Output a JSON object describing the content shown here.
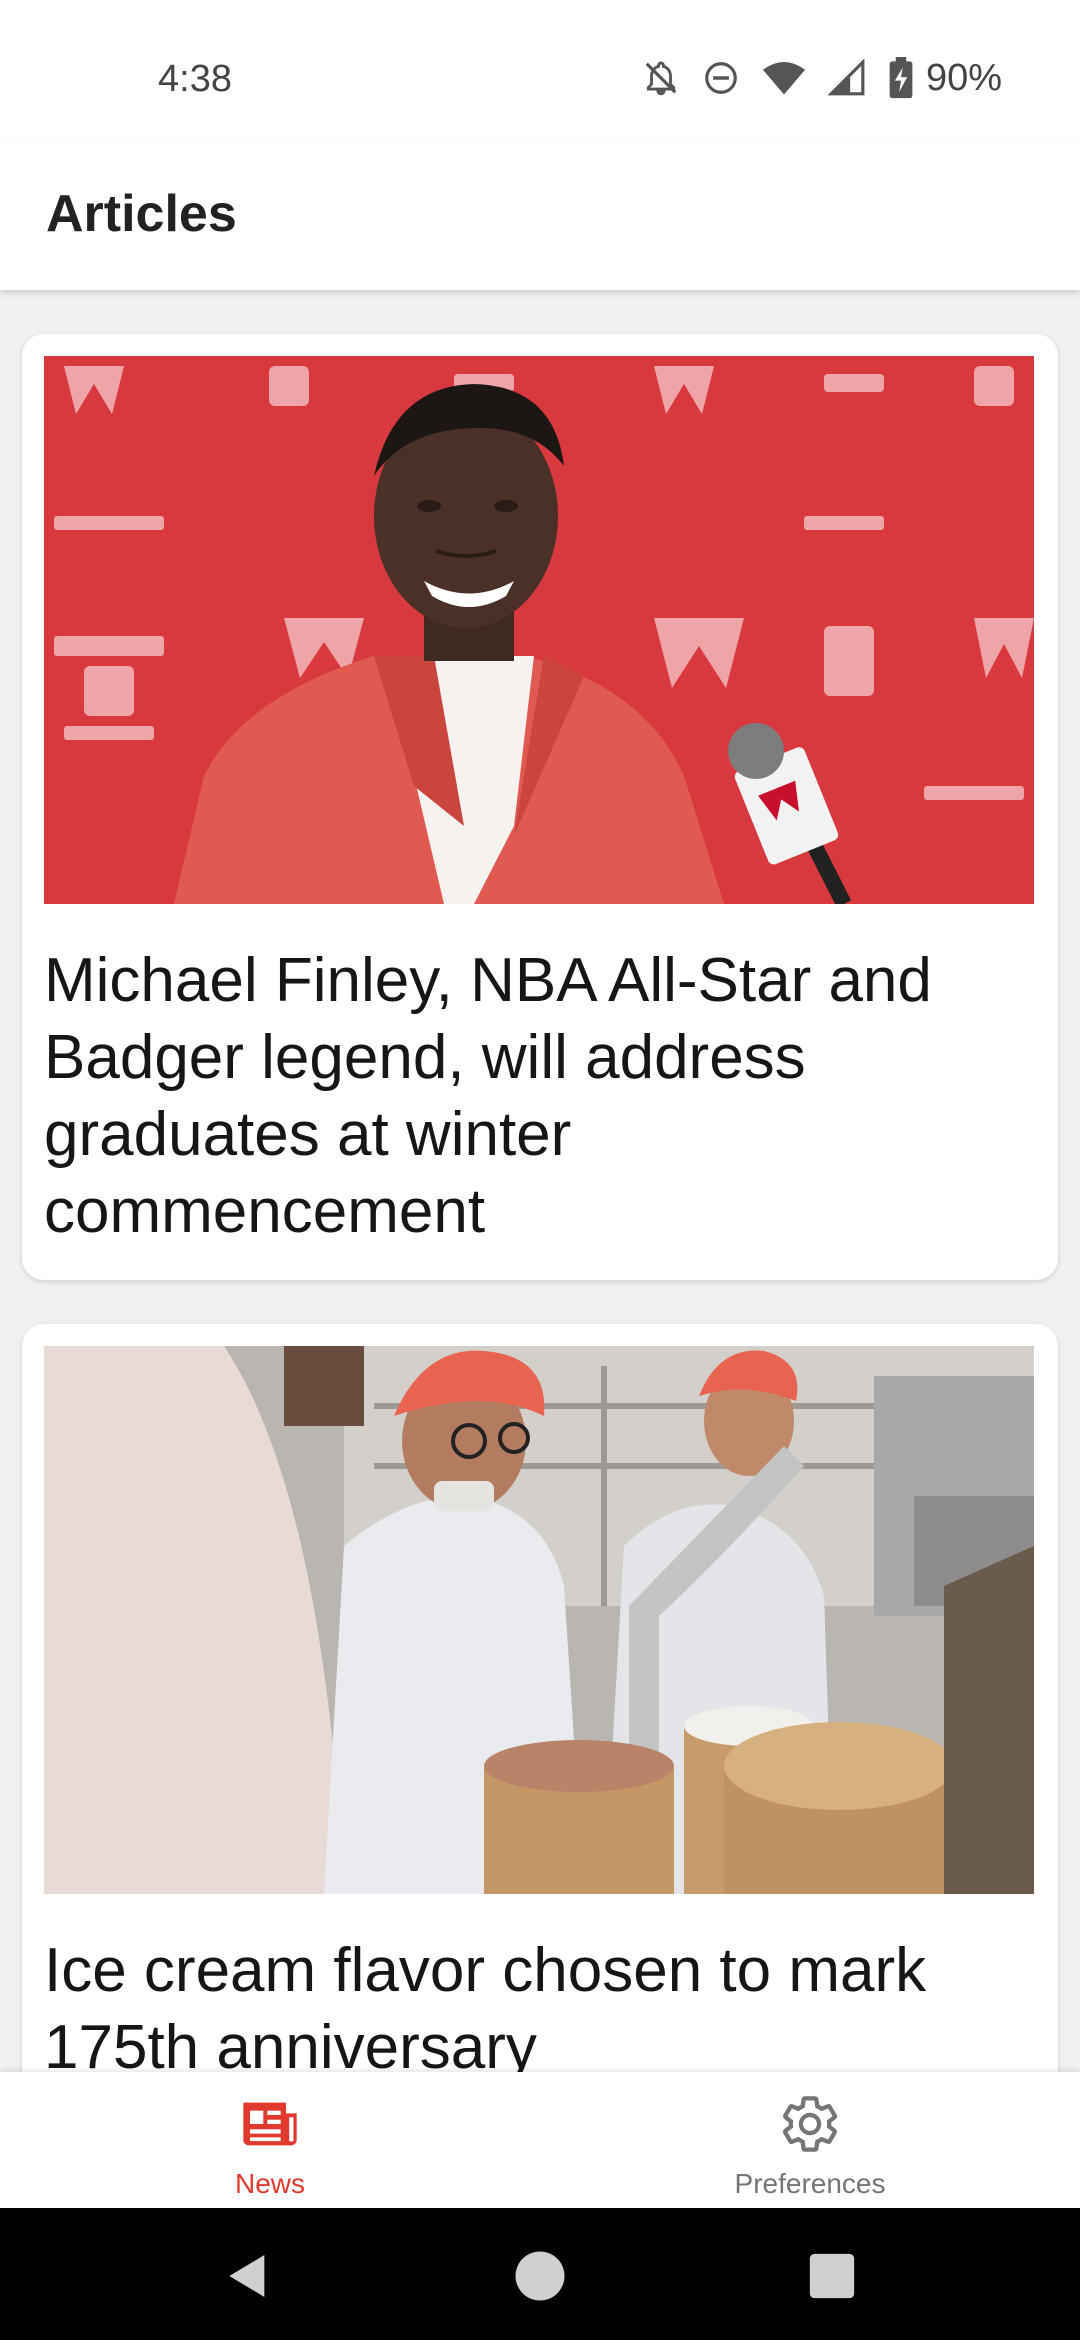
{
  "status_bar": {
    "time": "4:38",
    "battery": "90%",
    "icons": [
      "notifications-off-icon",
      "do-not-disturb-icon",
      "wifi-icon",
      "cell-signal-icon",
      "battery-charging-icon"
    ]
  },
  "app_bar": {
    "title": "Articles"
  },
  "articles": [
    {
      "title": "Michael Finley, NBA All-Star and Badger legend, will address graduates at winter commencement",
      "image": "Smiling man in red blazer at press conference microphone with Wisconsin backdrop"
    },
    {
      "title": "Ice cream flavor chosen to mark 175th anniversary",
      "image": "Students in hairnets and lab coats filling ice cream tubs in a dairy plant"
    }
  ],
  "bottom_nav": {
    "items": [
      {
        "label": "News",
        "icon": "newspaper-icon",
        "selected": true
      },
      {
        "label": "Preferences",
        "icon": "gear-icon",
        "selected": false
      }
    ]
  },
  "colors": {
    "accent": "#e03a2f",
    "inactive": "#757575",
    "background": "#f1f1f1",
    "card": "#ffffff"
  }
}
